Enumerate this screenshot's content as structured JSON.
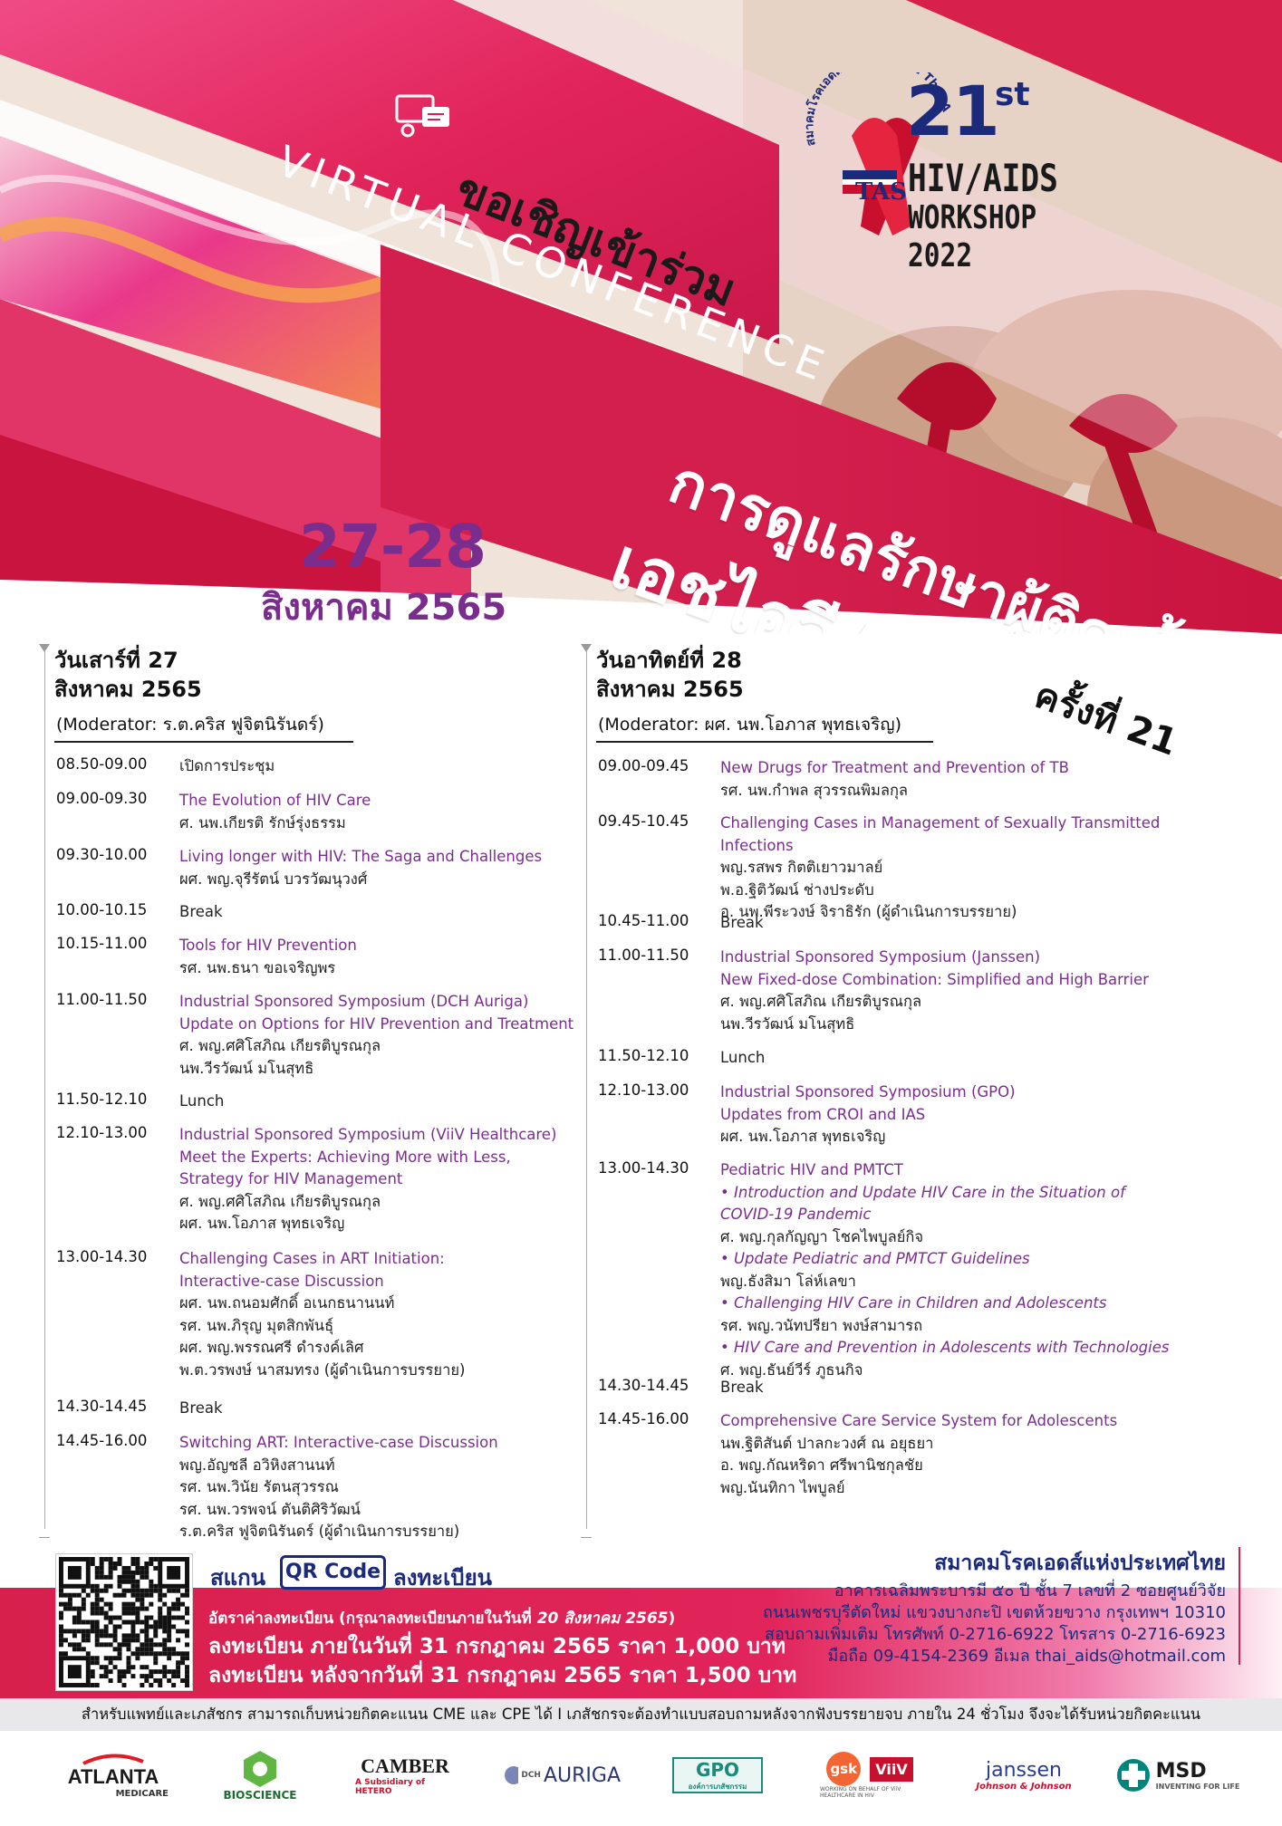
{
  "hero": {
    "invite_th": "ขอเชิญเข้าร่วม",
    "virtual_conference": "VIRTUAL CONFERENCE",
    "logo": {
      "society_text": "สมาคมโรคเอดส์แห่งประเทศไทย Thai AIDS Society",
      "abbr": "TAS"
    },
    "workshop": {
      "number": "21",
      "suffix": "st",
      "line1": "HIV/AIDS",
      "line2": "WORKSHOP",
      "line3": "2022"
    },
    "title_th_line1": "การดูแลรักษาผู้ติดเชื้อ",
    "title_th_line2": "เอชไอวี/เอดส์",
    "title_th_edition": "ครั้งที่ 21",
    "date_range": "27-28",
    "date_month_year": "สิงหาคม 2565"
  },
  "day1": {
    "heading_line1": "วันเสาร์ที่ 27",
    "heading_line2": "สิงหาคม 2565",
    "moderator": "(Moderator: ร.ต.คริส ฟูจิตนิรันดร์)",
    "sessions": [
      {
        "time": "08.50-09.00",
        "title": "",
        "plain": "เปิดการประชุม",
        "speakers": []
      },
      {
        "time": "09.00-09.30",
        "title": "The Evolution of HIV Care",
        "speakers": [
          "ศ. นพ.เกียรติ รักษ์รุ่งธรรม"
        ]
      },
      {
        "time": "09.30-10.00",
        "title": "Living longer with HIV: The Saga and Challenges",
        "speakers": [
          "ผศ. พญ.จุรีรัตน์ บวรวัฒนุวงศ์"
        ]
      },
      {
        "time": "10.00-10.15",
        "plain": "Break",
        "speakers": []
      },
      {
        "time": "10.15-11.00",
        "title": "Tools for HIV Prevention",
        "speakers": [
          "รศ. นพ.ธนา ขอเจริญพร"
        ]
      },
      {
        "time": "11.00-11.50",
        "title": "Industrial Sponsored Symposium (DCH Auriga)",
        "title2": "Update on Options for HIV Prevention and Treatment",
        "speakers": [
          "ศ. พญ.ศศิโสภิณ เกียรติบูรณกุล",
          "นพ.วีรวัฒน์ มโนสุทธิ"
        ]
      },
      {
        "time": "11.50-12.10",
        "plain": "Lunch",
        "speakers": []
      },
      {
        "time": "12.10-13.00",
        "title": "Industrial Sponsored Symposium (ViiV Healthcare)",
        "title2": "Meet the Experts: Achieving More with Less,",
        "title3": "Strategy for HIV Management",
        "speakers": [
          "ศ. พญ.ศศิโสภิณ เกียรติบูรณกุล",
          "ผศ. นพ.โอภาส พุทธเจริญ"
        ]
      },
      {
        "time": "13.00-14.30",
        "title": "Challenging Cases in ART Initiation:",
        "title2": "Interactive-case Discussion",
        "speakers": [
          "ผศ. นพ.ถนอมศักดิ์ อเนกธนานนท์",
          "รศ. นพ.ภิรุญ มุตสิกพันธุ์",
          "ผศ. พญ.พรรณศรี ดำรงค์เลิศ",
          "พ.ต.วรพงษ์ นาสมทรง (ผู้ดำเนินการบรรยาย)"
        ]
      },
      {
        "time": "14.30-14.45",
        "plain": "Break",
        "speakers": []
      },
      {
        "time": "14.45-16.00",
        "title": "Switching ART: Interactive-case Discussion",
        "speakers": [
          "พญ.อัญชลี อวิหิงสานนท์",
          "รศ. นพ.วินัย รัตนสุวรรณ",
          "รศ. นพ.วรพจน์ ตันติศิริวัฒน์",
          "ร.ต.คริส ฟูจิตนิรันดร์ (ผู้ดำเนินการบรรยาย)"
        ]
      }
    ]
  },
  "day2": {
    "heading_line1": "วันอาทิตย์ที่ 28",
    "heading_line2": "สิงหาคม 2565",
    "moderator": "(Moderator: ผศ. นพ.โอภาส พุทธเจริญ)",
    "sessions": [
      {
        "time": "09.00-09.45",
        "title": "New Drugs for Treatment and Prevention of TB",
        "speakers": [
          "รศ. นพ.กำพล สุวรรณพิมลกุล"
        ]
      },
      {
        "time": "09.45-10.45",
        "title": "Challenging Cases in Management of Sexually Transmitted Infections",
        "speakers": [
          "พญ.รสพร กิตติเยาวมาลย์",
          "พ.อ.ฐิติวัฒน์ ช่างประดับ",
          "อ. นพ.พีระวงษ์ จิราธิรัก (ผู้ดำเนินการบรรยาย)"
        ]
      },
      {
        "time": "10.45-11.00",
        "plain": "Break",
        "speakers": []
      },
      {
        "time": "11.00-11.50",
        "title": "Industrial Sponsored Symposium (Janssen)",
        "title2": "New Fixed-dose Combination: Simplified and High Barrier",
        "speakers": [
          "ศ. พญ.ศศิโสภิณ เกียรติบูรณกุล",
          "นพ.วีรวัฒน์ มโนสุทธิ"
        ]
      },
      {
        "time": "11.50-12.10",
        "plain": "Lunch",
        "speakers": []
      },
      {
        "time": "12.10-13.00",
        "title": "Industrial Sponsored Symposium (GPO)",
        "title2": "Updates from CROI and IAS",
        "speakers": [
          "ผศ. นพ.โอภาส พุทธเจริญ"
        ]
      },
      {
        "time": "13.00-14.30",
        "title": "Pediatric HIV and PMTCT",
        "bullets": [
          {
            "text": "Introduction and Update HIV Care in the Situation of COVID-19 Pandemic",
            "speaker": "ศ. พญ.กุลกัญญา โชคไพบูลย์กิจ"
          },
          {
            "text": "Update Pediatric and PMTCT Guidelines",
            "speaker": "พญ.ธังสิมา โล่ห์เลขา"
          },
          {
            "text": "Challenging HIV Care in Children and Adolescents",
            "speaker": "รศ. พญ.วนัทปรียา พงษ์สามารถ"
          },
          {
            "text": "HIV Care and Prevention in Adolescents with Technologies",
            "speaker": "ศ. พญ.ธันย์วีร์ ภูธนกิจ"
          }
        ],
        "speakers": []
      },
      {
        "time": "14.30-14.45",
        "plain": "Break",
        "speakers": []
      },
      {
        "time": "14.45-16.00",
        "title": "Comprehensive Care Service System for Adolescents",
        "speakers": [
          "นพ.ฐิติสันต์ ปาลกะวงศ์ ณ อยุธยา",
          "อ. พญ.กัณหริดา ศรีพานิชกุลชัย",
          "พญ.นันทิกา ไพบูลย์"
        ]
      }
    ]
  },
  "registration": {
    "scan_prefix": "สแกน",
    "qr_label": "QR Code",
    "scan_suffix": "ลงทะเบียน",
    "note_prefix": "อัตราค่าลงทะเบียน (กรุณาลงทะเบียนภายในวันที่",
    "note_date": "20 สิงหาคม 2565",
    "note_suffix": ")",
    "line1": "ลงทะเบียน ภายในวันที่ 31 กรกฎาคม 2565 ราคา 1,000 บาท",
    "line2": "ลงทะเบียน หลังจากวันที่  31 กรกฎาคม 2565 ราคา 1,500 บาท"
  },
  "organizer": {
    "name": "สมาคมโรคเอดส์แห่งประเทศไทย",
    "addr1": "อาคารเฉลิมพระบารมี ๕๐ ปี ชั้น 7 เลขที่ 2 ซอยศูนย์วิจัย",
    "addr2": "ถนนเพชรบุรีตัดใหม่ แขวงบางกะปิ เขตห้วยขวาง กรุงเทพฯ 10310",
    "phone": "สอบถามเพิ่มเติม โทรศัพท์ 0-2716-6922 โทรสาร 0-2716-6923",
    "mobile": "มือถือ 09-4154-2369 อีเมล thai_aids@hotmail.com"
  },
  "cme_note": "สำหรับแพทย์และเภสัชกร สามารถเก็บหน่วยกิตคะแนน CME และ CPE ได้ I เภสัชกรจะต้องทำแบบสอบถามหลังจากฟังบรรยายจบ ภายใน 24 ชั่วโมง จึงจะได้รับหน่วยกิตคะแนน",
  "sponsors": {
    "atlanta": {
      "name": "ATLANTA",
      "sub": "MEDICARE"
    },
    "bioscience": {
      "name": "BIOSCIENCE"
    },
    "camber": {
      "name": "CAMBER",
      "sub": "A Subsidiary of HETERO"
    },
    "auriga": {
      "name": "AURIGA",
      "pre": "DCH"
    },
    "gpo": {
      "name": "GPO",
      "sub": "องค์การเภสัชกรรม"
    },
    "viiv": {
      "name1": "gsk",
      "name2": "ViiV",
      "sub": "WORKING ON BEHALF OF ViiV HEALTHCARE IN HIV"
    },
    "janssen": {
      "name": "janssen",
      "sub": "Johnson & Johnson"
    },
    "msd": {
      "name": "MSD",
      "sub": "INVENTING FOR LIFE"
    }
  },
  "colors": {
    "purple": "#7b2d8e",
    "navy": "#1b2a7a",
    "red": "#d8204d",
    "pink": "#e83e74"
  }
}
